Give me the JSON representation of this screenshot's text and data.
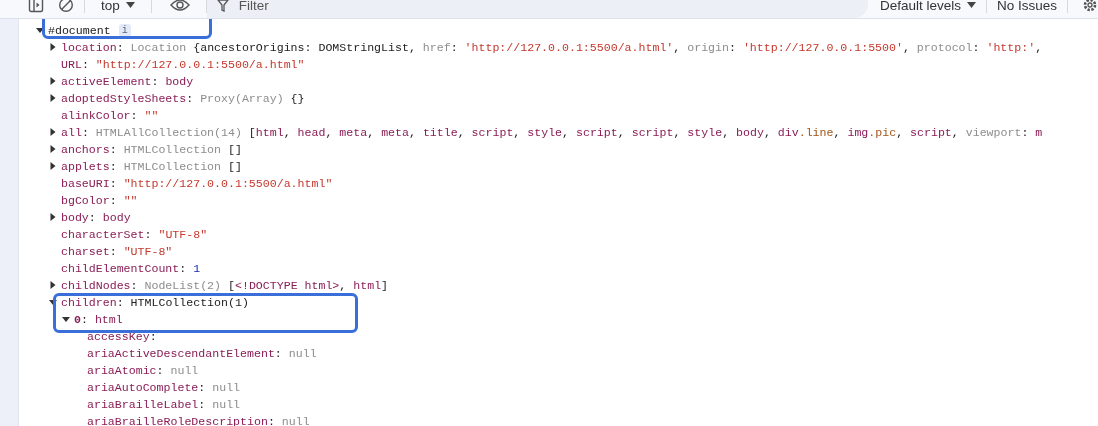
{
  "toolbar": {
    "context": "top",
    "filter": {
      "placeholder": "Filter"
    },
    "levels": "Default levels",
    "issues": "No Issues"
  },
  "tree": {
    "key": "#document",
    "kind": "expandable",
    "expanded": true,
    "badge": "i",
    "highlighted": true,
    "children": [
      {
        "key": "location",
        "kind": "expandable",
        "expanded": false,
        "value": [
          {
            "t": ": ",
            "kind": "plain"
          },
          {
            "t": "Location ",
            "kind": "dim"
          },
          {
            "t": "{ancestorOrigins: DOMStringList, ",
            "kind": "plain"
          },
          {
            "t": "href",
            "kind": "dim"
          },
          {
            "t": ": ",
            "kind": "plain"
          },
          {
            "t": "'http://127.0.0.1:5500/a.html'",
            "kind": "string"
          },
          {
            "t": ", ",
            "kind": "plain"
          },
          {
            "t": "origin",
            "kind": "dim"
          },
          {
            "t": ": ",
            "kind": "plain"
          },
          {
            "t": "'http://127.0.0.1:5500'",
            "kind": "string"
          },
          {
            "t": ", ",
            "kind": "plain"
          },
          {
            "t": "protocol",
            "kind": "dim"
          },
          {
            "t": ": ",
            "kind": "plain"
          },
          {
            "t": "'http:'",
            "kind": "string"
          },
          {
            "t": ",",
            "kind": "plain"
          }
        ]
      },
      {
        "key": "URL",
        "kind": "leaf",
        "value": [
          {
            "t": ": ",
            "kind": "plain"
          },
          {
            "t": "\"http://127.0.0.1:5500/a.html\"",
            "kind": "string"
          }
        ]
      },
      {
        "key": "activeElement",
        "kind": "expandable",
        "expanded": false,
        "value": [
          {
            "t": ": ",
            "kind": "plain"
          },
          {
            "t": "body",
            "kind": "tag"
          }
        ]
      },
      {
        "key": "adoptedStyleSheets",
        "kind": "expandable",
        "expanded": false,
        "value": [
          {
            "t": ": ",
            "kind": "plain"
          },
          {
            "t": "Proxy(Array) ",
            "kind": "dim"
          },
          {
            "t": "{}",
            "kind": "plain"
          }
        ]
      },
      {
        "key": "alinkColor",
        "kind": "leaf",
        "value": [
          {
            "t": ": ",
            "kind": "plain"
          },
          {
            "t": "\"\"",
            "kind": "string"
          }
        ]
      },
      {
        "key": "all",
        "kind": "expandable",
        "expanded": false,
        "value": [
          {
            "t": ": ",
            "kind": "plain"
          },
          {
            "t": "HTMLAllCollection(14) ",
            "kind": "dim"
          },
          {
            "t": "[",
            "kind": "plain"
          },
          {
            "t": "html",
            "kind": "tag"
          },
          {
            "t": ", ",
            "kind": "plain"
          },
          {
            "t": "head",
            "kind": "tag"
          },
          {
            "t": ", ",
            "kind": "plain"
          },
          {
            "t": "meta",
            "kind": "tag"
          },
          {
            "t": ", ",
            "kind": "plain"
          },
          {
            "t": "meta",
            "kind": "tag"
          },
          {
            "t": ", ",
            "kind": "plain"
          },
          {
            "t": "title",
            "kind": "tag"
          },
          {
            "t": ", ",
            "kind": "plain"
          },
          {
            "t": "script",
            "kind": "tag"
          },
          {
            "t": ", ",
            "kind": "plain"
          },
          {
            "t": "style",
            "kind": "tag"
          },
          {
            "t": ", ",
            "kind": "plain"
          },
          {
            "t": "script",
            "kind": "tag"
          },
          {
            "t": ", ",
            "kind": "plain"
          },
          {
            "t": "script",
            "kind": "tag"
          },
          {
            "t": ", ",
            "kind": "plain"
          },
          {
            "t": "style",
            "kind": "tag"
          },
          {
            "t": ", ",
            "kind": "plain"
          },
          {
            "t": "body",
            "kind": "tag"
          },
          {
            "t": ", ",
            "kind": "plain"
          },
          {
            "t": "div",
            "kind": "tag"
          },
          {
            "t": ".line",
            "kind": "class"
          },
          {
            "t": ", ",
            "kind": "plain"
          },
          {
            "t": "img",
            "kind": "tag"
          },
          {
            "t": ".pic",
            "kind": "class"
          },
          {
            "t": ", ",
            "kind": "plain"
          },
          {
            "t": "script",
            "kind": "tag"
          },
          {
            "t": ", ",
            "kind": "plain"
          },
          {
            "t": "viewport",
            "kind": "dim"
          },
          {
            "t": ": ",
            "kind": "plain"
          },
          {
            "t": "m",
            "kind": "tag"
          }
        ]
      },
      {
        "key": "anchors",
        "kind": "expandable",
        "expanded": false,
        "value": [
          {
            "t": ": ",
            "kind": "plain"
          },
          {
            "t": "HTMLCollection ",
            "kind": "dim"
          },
          {
            "t": "[]",
            "kind": "plain"
          }
        ]
      },
      {
        "key": "applets",
        "kind": "expandable",
        "expanded": false,
        "value": [
          {
            "t": ": ",
            "kind": "plain"
          },
          {
            "t": "HTMLCollection ",
            "kind": "dim"
          },
          {
            "t": "[]",
            "kind": "plain"
          }
        ]
      },
      {
        "key": "baseURI",
        "kind": "leaf",
        "value": [
          {
            "t": ": ",
            "kind": "plain"
          },
          {
            "t": "\"http://127.0.0.1:5500/a.html\"",
            "kind": "string"
          }
        ]
      },
      {
        "key": "bgColor",
        "kind": "leaf",
        "value": [
          {
            "t": ": ",
            "kind": "plain"
          },
          {
            "t": "\"\"",
            "kind": "string"
          }
        ]
      },
      {
        "key": "body",
        "kind": "expandable",
        "expanded": false,
        "value": [
          {
            "t": ": ",
            "kind": "plain"
          },
          {
            "t": "body",
            "kind": "tag"
          }
        ]
      },
      {
        "key": "characterSet",
        "kind": "leaf",
        "value": [
          {
            "t": ": ",
            "kind": "plain"
          },
          {
            "t": "\"UTF-8\"",
            "kind": "string"
          }
        ]
      },
      {
        "key": "charset",
        "kind": "leaf",
        "value": [
          {
            "t": ": ",
            "kind": "plain"
          },
          {
            "t": "\"UTF-8\"",
            "kind": "string"
          }
        ]
      },
      {
        "key": "childElementCount",
        "kind": "leaf",
        "value": [
          {
            "t": ": ",
            "kind": "plain"
          },
          {
            "t": "1",
            "kind": "number"
          }
        ]
      },
      {
        "key": "childNodes",
        "kind": "expandable",
        "expanded": false,
        "value": [
          {
            "t": ": ",
            "kind": "plain"
          },
          {
            "t": "NodeList(2) ",
            "kind": "dim"
          },
          {
            "t": "[",
            "kind": "plain"
          },
          {
            "t": "<!DOCTYPE html>",
            "kind": "tag"
          },
          {
            "t": ", ",
            "kind": "plain"
          },
          {
            "t": "html",
            "kind": "tag"
          },
          {
            "t": "]",
            "kind": "plain"
          }
        ]
      },
      {
        "key": "children",
        "kind": "expandable",
        "expanded": true,
        "highlighted": true,
        "value": [
          {
            "t": ": ",
            "kind": "plain"
          },
          {
            "t": "HTMLCollection(1)",
            "kind": "plain"
          }
        ],
        "children": [
          {
            "key": "0",
            "index": true,
            "kind": "expandable",
            "expanded": true,
            "value": [
              {
                "t": ": ",
                "kind": "plain"
              },
              {
                "t": "html",
                "kind": "tag"
              }
            ],
            "children": [
              {
                "key": "accessKey",
                "kind": "leaf",
                "value": [
                  {
                    "t": ":",
                    "kind": "plain"
                  }
                ]
              },
              {
                "key": "ariaActiveDescendantElement",
                "kind": "leaf",
                "value": [
                  {
                    "t": ": ",
                    "kind": "plain"
                  },
                  {
                    "t": "null",
                    "kind": "dim"
                  }
                ]
              },
              {
                "key": "ariaAtomic",
                "kind": "leaf",
                "value": [
                  {
                    "t": ": ",
                    "kind": "plain"
                  },
                  {
                    "t": "null",
                    "kind": "dim"
                  }
                ]
              },
              {
                "key": "ariaAutoComplete",
                "kind": "leaf",
                "value": [
                  {
                    "t": ": ",
                    "kind": "plain"
                  },
                  {
                    "t": "null",
                    "kind": "dim"
                  }
                ]
              },
              {
                "key": "ariaBrailleLabel",
                "kind": "leaf",
                "value": [
                  {
                    "t": ": ",
                    "kind": "plain"
                  },
                  {
                    "t": "null",
                    "kind": "dim"
                  }
                ]
              },
              {
                "key": "ariaBrailleRoleDescription",
                "kind": "leaf",
                "value": [
                  {
                    "t": ": ",
                    "kind": "plain"
                  },
                  {
                    "t": "null",
                    "kind": "dim"
                  }
                ]
              }
            ]
          }
        ]
      }
    ]
  }
}
